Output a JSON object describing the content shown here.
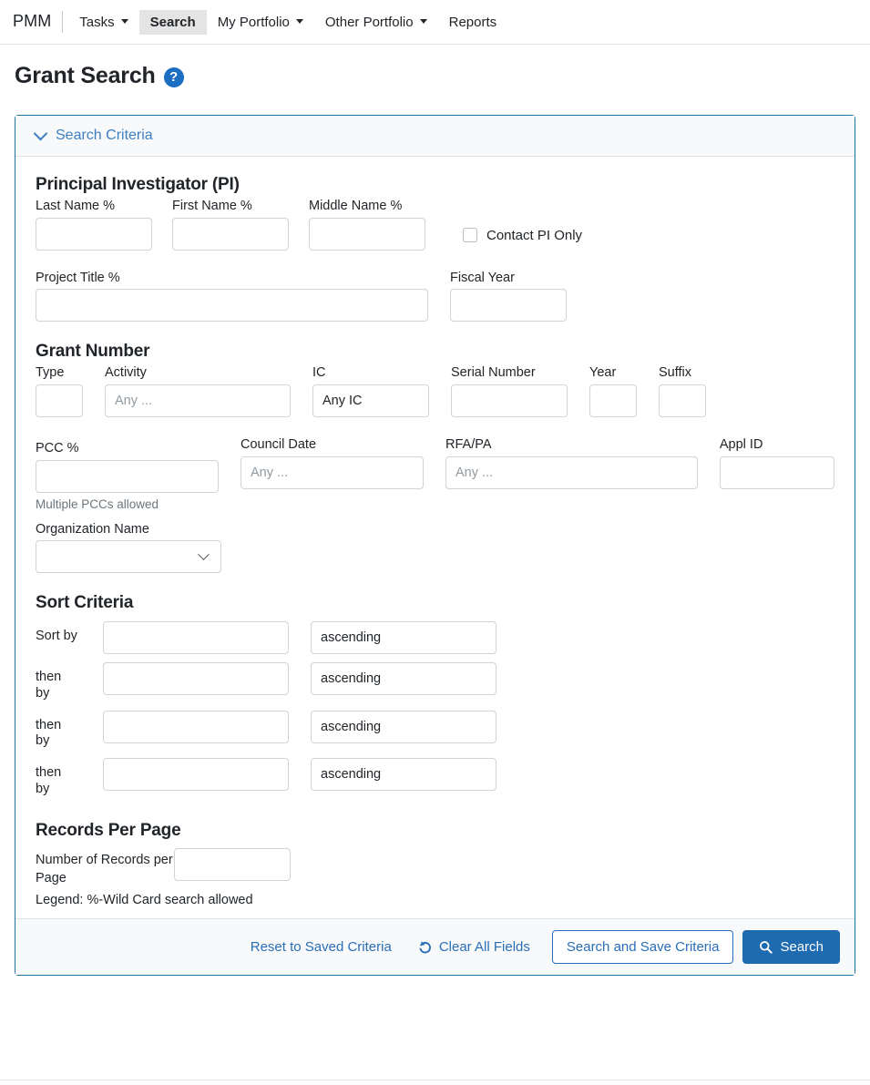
{
  "navbar": {
    "brand": "PMM",
    "items": [
      {
        "label": "Tasks",
        "has_caret": true,
        "active": false
      },
      {
        "label": "Search",
        "has_caret": false,
        "active": true
      },
      {
        "label": "My Portfolio",
        "has_caret": true,
        "active": false
      },
      {
        "label": "Other Portfolio",
        "has_caret": true,
        "active": false
      },
      {
        "label": "Reports",
        "has_caret": false,
        "active": false
      }
    ]
  },
  "page": {
    "title": "Grant Search",
    "help_icon": "question-mark-circle-icon",
    "help_glyph": "?"
  },
  "card": {
    "header_label": "Search Criteria",
    "header_icon": "chevron-down-icon"
  },
  "pi_section": {
    "heading": "Principal Investigator (PI)",
    "last_name": {
      "label": "Last Name %",
      "value": "",
      "placeholder": ""
    },
    "first_name": {
      "label": "First Name %",
      "value": "",
      "placeholder": ""
    },
    "middle_name": {
      "label": "Middle Name %",
      "value": "",
      "placeholder": ""
    },
    "contact_pi_only": {
      "label": "Contact PI Only",
      "checked": false
    }
  },
  "project": {
    "project_title": {
      "label": "Project Title %",
      "value": "",
      "placeholder": ""
    },
    "fiscal_year": {
      "label": "Fiscal Year",
      "value": "",
      "placeholder": ""
    }
  },
  "grant_number": {
    "heading": "Grant Number",
    "type": {
      "label": "Type",
      "value": "",
      "placeholder": ""
    },
    "activity": {
      "label": "Activity",
      "value": "",
      "placeholder": "Any ..."
    },
    "ic": {
      "label": "IC",
      "value": "Any IC"
    },
    "serial_number": {
      "label": "Serial Number",
      "value": "",
      "placeholder": ""
    },
    "year": {
      "label": "Year",
      "value": "",
      "placeholder": ""
    },
    "suffix": {
      "label": "Suffix",
      "value": "",
      "placeholder": ""
    },
    "pcc": {
      "label": "PCC %",
      "value": "",
      "placeholder": "",
      "hint": "Multiple PCCs allowed"
    },
    "council_date": {
      "label": "Council Date",
      "value": "",
      "placeholder": "Any ..."
    },
    "rfa_pa": {
      "label": "RFA/PA",
      "value": "",
      "placeholder": "Any ..."
    },
    "appl_id": {
      "label": "Appl ID",
      "value": "",
      "placeholder": ""
    },
    "organization_name": {
      "label": "Organization Name",
      "value": "",
      "icon": "chevron-down-icon"
    }
  },
  "sort_criteria": {
    "heading": "Sort Criteria",
    "rows": [
      {
        "lead": "Sort by",
        "field": "",
        "direction": "ascending"
      },
      {
        "lead": "then by",
        "field": "",
        "direction": "ascending"
      },
      {
        "lead": "then by",
        "field": "",
        "direction": "ascending"
      },
      {
        "lead": "then by",
        "field": "",
        "direction": "ascending"
      }
    ]
  },
  "records_per_page": {
    "heading": "Records Per Page",
    "label": "Number of Records per Page",
    "value": "",
    "legend": "Legend: %-Wild Card search allowed"
  },
  "footer": {
    "reset_label": "Reset to Saved Criteria",
    "clear_label": "Clear All Fields",
    "clear_icon": "undo-arrow-icon",
    "search_save_label": "Search and Save Criteria",
    "search_label": "Search",
    "search_icon": "magnifier-icon"
  },
  "colors": {
    "primary": "#1f6bb0",
    "link": "#2a6eb5",
    "card_border": "#2272a8",
    "header_bg": "#f7f9fa",
    "input_border": "#ced4da",
    "placeholder": "#919aa1",
    "nav_active_bg": "#e4e4e4"
  }
}
